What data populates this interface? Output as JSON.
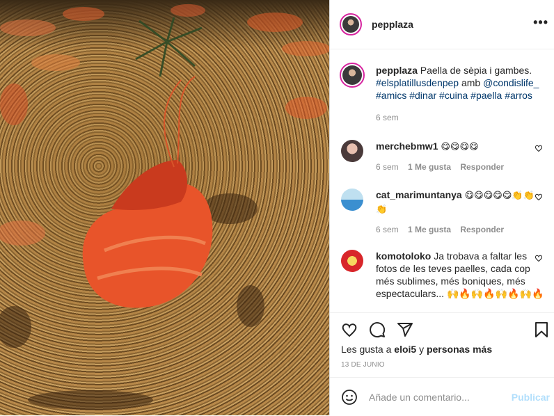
{
  "post": {
    "username": "pepplaza",
    "more_label": "•••"
  },
  "caption": {
    "username": "pepplaza",
    "text": "Paella de sèpia i gambes.",
    "hashtag1": "#elsplatillusdenpep",
    "connector": "amb",
    "mention": "@condislife_",
    "hashtags": "#amics #dinar #cuina #paella #arros",
    "time": "6 sem"
  },
  "comments": [
    {
      "username": "merchebmw1",
      "text": "😋😋😋😋",
      "time": "6 sem",
      "likes": "1 Me gusta",
      "reply": "Responder"
    },
    {
      "username": "cat_marimuntanya",
      "text": "😋😋😋😋😋👏👏👏",
      "time": "6 sem",
      "likes": "1 Me gusta",
      "reply": "Responder"
    },
    {
      "username": "komotoloko",
      "text": "Ja trobava a faltar les fotos de les teves paelles, cada cop més sublimes, més boniques, més espectaculars... 🙌🔥🙌🔥🙌🔥🙌🔥"
    }
  ],
  "likes": {
    "prefix": "Les gusta a",
    "user": "eloi5",
    "connector": "y",
    "others": "personas más"
  },
  "date": "13 DE JUNIO",
  "comment_box": {
    "placeholder": "Añade un comentario...",
    "publish": "Publicar"
  },
  "colors": {
    "link": "#00376b",
    "muted": "#8e8e8e",
    "publish_disabled": "#b2dffc"
  }
}
